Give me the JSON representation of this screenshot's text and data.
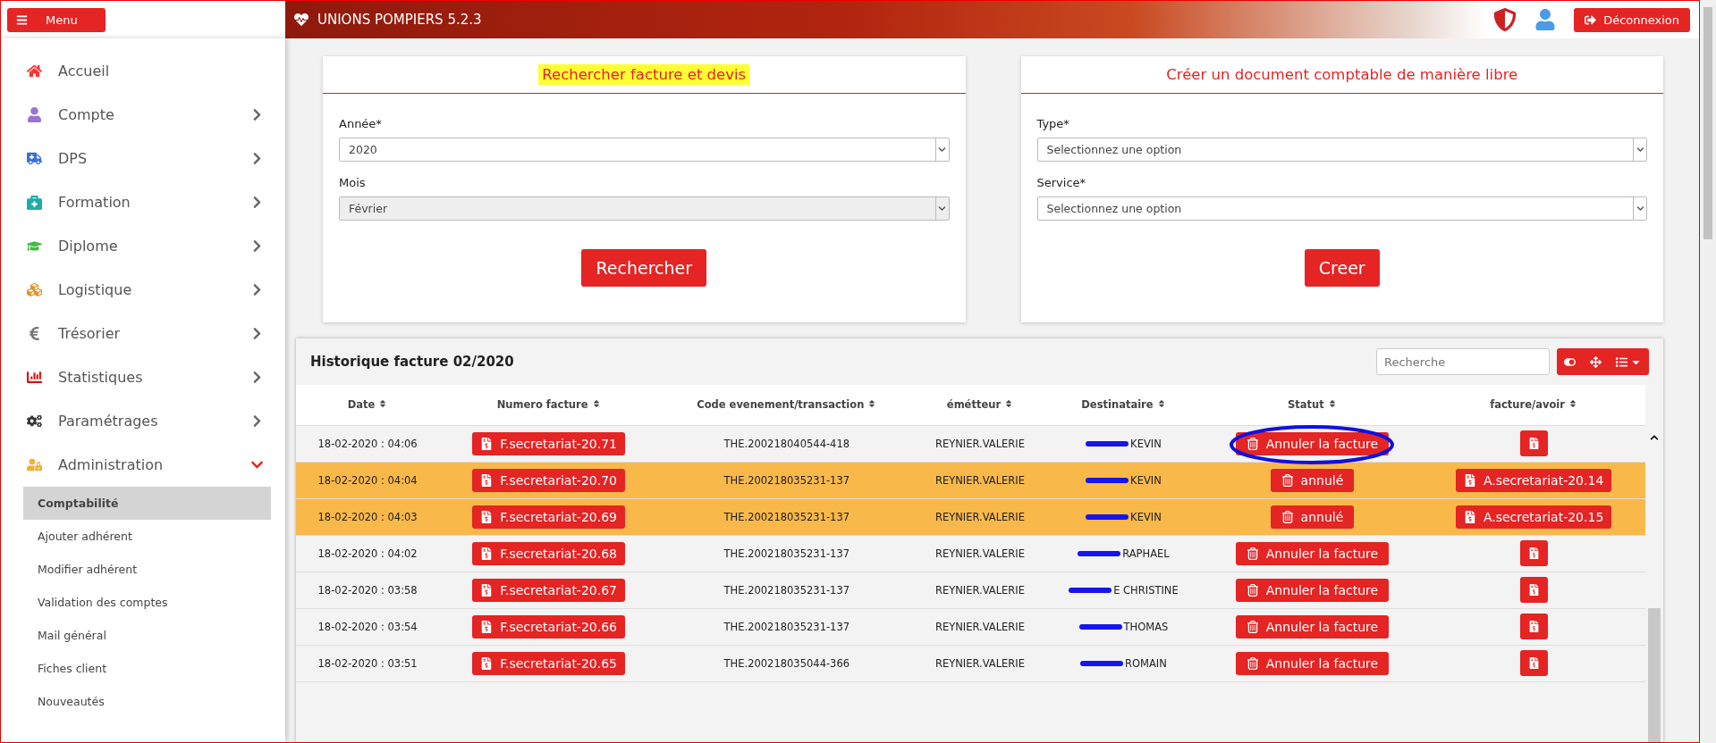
{
  "header": {
    "menu_button": "Menu",
    "title": "UNIONS POMPIERS 5.2.3",
    "logout_button": "Déconnexion"
  },
  "sidebar": {
    "items": [
      {
        "label": "Accueil"
      },
      {
        "label": "Compte",
        "expanded": false
      },
      {
        "label": "DPS",
        "expanded": false
      },
      {
        "label": "Formation",
        "expanded": false
      },
      {
        "label": "Diplome",
        "expanded": false
      },
      {
        "label": "Logistique",
        "expanded": false
      },
      {
        "label": "Trésorier",
        "expanded": false
      },
      {
        "label": "Statistiques",
        "expanded": false
      },
      {
        "label": "Paramétrages",
        "expanded": false
      },
      {
        "label": "Administration",
        "expanded": true,
        "children": [
          {
            "label": "Comptabilité",
            "selected": true
          },
          {
            "label": "Ajouter adhérent",
            "selected": false
          },
          {
            "label": "Modifier adhérent",
            "selected": false
          },
          {
            "label": "Validation des comptes",
            "selected": false
          },
          {
            "label": "Mail général",
            "selected": false
          },
          {
            "label": "Fiches client",
            "selected": false
          },
          {
            "label": "Nouveautés",
            "selected": false
          }
        ]
      }
    ]
  },
  "search_card": {
    "title": "Rechercher facture et devis",
    "highlighted": true,
    "fields": [
      {
        "label": "Année*",
        "value": "2020",
        "disabled": false
      },
      {
        "label": "Mois",
        "value": "Février",
        "disabled": true
      }
    ],
    "button": "Rechercher"
  },
  "create_card": {
    "title": "Créer un document comptable de manière libre",
    "highlighted": false,
    "fields": [
      {
        "label": "Type*",
        "value": "Selectionnez une option",
        "disabled": false
      },
      {
        "label": "Service*",
        "value": "Selectionnez une option",
        "disabled": false
      }
    ],
    "button": "Creer"
  },
  "table": {
    "title": "Historique facture 02/2020",
    "search": {
      "placeholder": "Recherche"
    },
    "columns": [
      "Date",
      "Numero facture",
      "Code evenement/transaction",
      "émétteur",
      "Destinataire",
      "Statut",
      "facture/avoir"
    ],
    "rows": [
      {
        "date": "18-02-2020 : 04:06",
        "numero": "F.secretariat-20.71",
        "code": "THE.200218040544-418",
        "emetteur": "REYNIER.VALERIE",
        "destinataire": "KEVIN",
        "statut": "Annuler la facture",
        "cancelled": false,
        "circled": true
      },
      {
        "date": "18-02-2020 : 04:04",
        "numero": "F.secretariat-20.70",
        "code": "THE.200218035231-137",
        "emetteur": "REYNIER.VALERIE",
        "destinataire": "KEVIN",
        "statut": "annulé",
        "cancelled": true,
        "avoir": "A.secretariat-20.14",
        "circled": false
      },
      {
        "date": "18-02-2020 : 04:03",
        "numero": "F.secretariat-20.69",
        "code": "THE.200218035231-137",
        "emetteur": "REYNIER.VALERIE",
        "destinataire": "KEVIN",
        "statut": "annulé",
        "cancelled": true,
        "avoir": "A.secretariat-20.15",
        "circled": false
      },
      {
        "date": "18-02-2020 : 04:02",
        "numero": "F.secretariat-20.68",
        "code": "THE.200218035231-137",
        "emetteur": "REYNIER.VALERIE",
        "destinataire": "RAPHAEL",
        "statut": "Annuler la facture",
        "cancelled": false,
        "circled": false
      },
      {
        "date": "18-02-2020 : 03:58",
        "numero": "F.secretariat-20.67",
        "code": "THE.200218035231-137",
        "emetteur": "REYNIER.VALERIE",
        "destinataire": "E CHRISTINE",
        "statut": "Annuler la facture",
        "cancelled": false,
        "circled": false
      },
      {
        "date": "18-02-2020 : 03:54",
        "numero": "F.secretariat-20.66",
        "code": "THE.200218035231-137",
        "emetteur": "REYNIER.VALERIE",
        "destinataire": "THOMAS",
        "statut": "Annuler la facture",
        "cancelled": false,
        "circled": false
      },
      {
        "date": "18-02-2020 : 03:51",
        "numero": "F.secretariat-20.65",
        "code": "THE.200218035044-366",
        "emetteur": "REYNIER.VALERIE",
        "destinataire": "ROMAIN",
        "statut": "Annuler la facture",
        "cancelled": false,
        "circled": false
      }
    ]
  }
}
